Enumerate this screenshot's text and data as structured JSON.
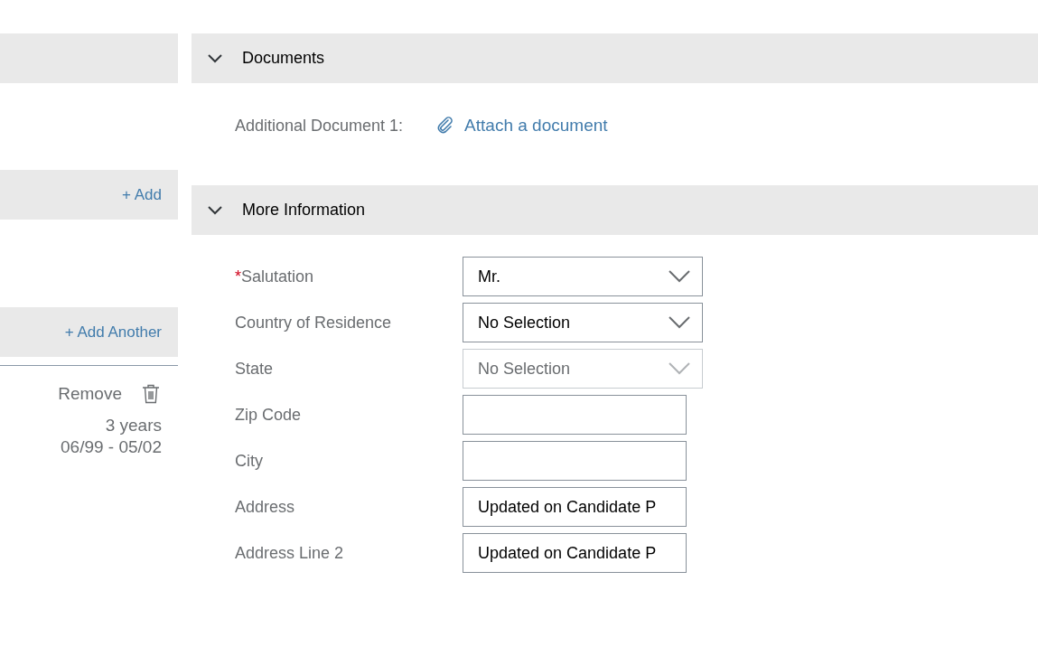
{
  "left_panel": {
    "actions": [
      "+ Add",
      "+ Add Another"
    ],
    "entry": {
      "remove_label": "Remove",
      "duration": "3 years",
      "period": "06/99 - 05/02"
    }
  },
  "sections": [
    {
      "kind": "documents",
      "title": "Documents",
      "expanded": true,
      "document_label": "Additional Document 1:",
      "attach_link": "Attach a document"
    },
    {
      "kind": "form",
      "title": "More Information",
      "expanded": true,
      "required_mark": "*",
      "fields": [
        {
          "kind": "dropdown",
          "label": "Salutation",
          "required": true,
          "value": "Mr.",
          "disabled": false
        },
        {
          "kind": "dropdown",
          "label": "Country of Residence",
          "required": false,
          "value": "No Selection",
          "disabled": false
        },
        {
          "kind": "dropdown",
          "label": "State",
          "required": false,
          "value": "No Selection",
          "disabled": true
        },
        {
          "kind": "text",
          "label": "Zip Code",
          "required": false,
          "disabled": false
        },
        {
          "kind": "text",
          "label": "City",
          "required": false,
          "disabled": false
        },
        {
          "kind": "text",
          "label": "Address",
          "required": false,
          "value": "Updated on Candidate P",
          "disabled": false
        },
        {
          "kind": "text",
          "label": "Address Line 2",
          "required": false,
          "value": "Updated on Candidate P",
          "disabled": false
        }
      ]
    }
  ]
}
